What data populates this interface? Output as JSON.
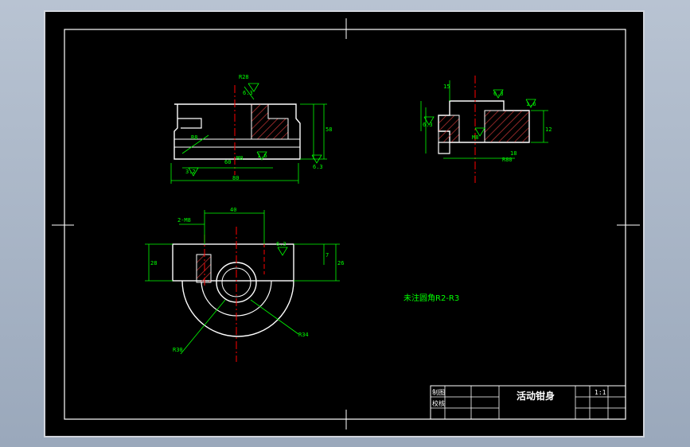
{
  "colors": {
    "background": "#000000",
    "outline": "#ffffff",
    "dimension": "#00ff00",
    "centerline": "#ff0000",
    "hatch": "#b03030",
    "note": "#00ff00",
    "title_text": "#ffffff"
  },
  "drawing": {
    "note": "未注圆角R2-R3",
    "part_name": "活动钳身",
    "scale": "1:1",
    "title_block_labels": [
      "制图",
      "校核"
    ]
  },
  "dimensions": {
    "front_view": [
      "R28",
      "6.3",
      "R8",
      "58",
      "80",
      "60",
      "M8",
      "1.6",
      "6.3",
      "3.2"
    ],
    "side_view": [
      "15",
      "6.3",
      "1.6",
      "M8",
      "6.3",
      "12",
      "18",
      "R80"
    ],
    "top_view": [
      "40",
      "2-M8",
      "6.3",
      "7",
      "26",
      "28",
      "R30",
      "R34"
    ]
  }
}
